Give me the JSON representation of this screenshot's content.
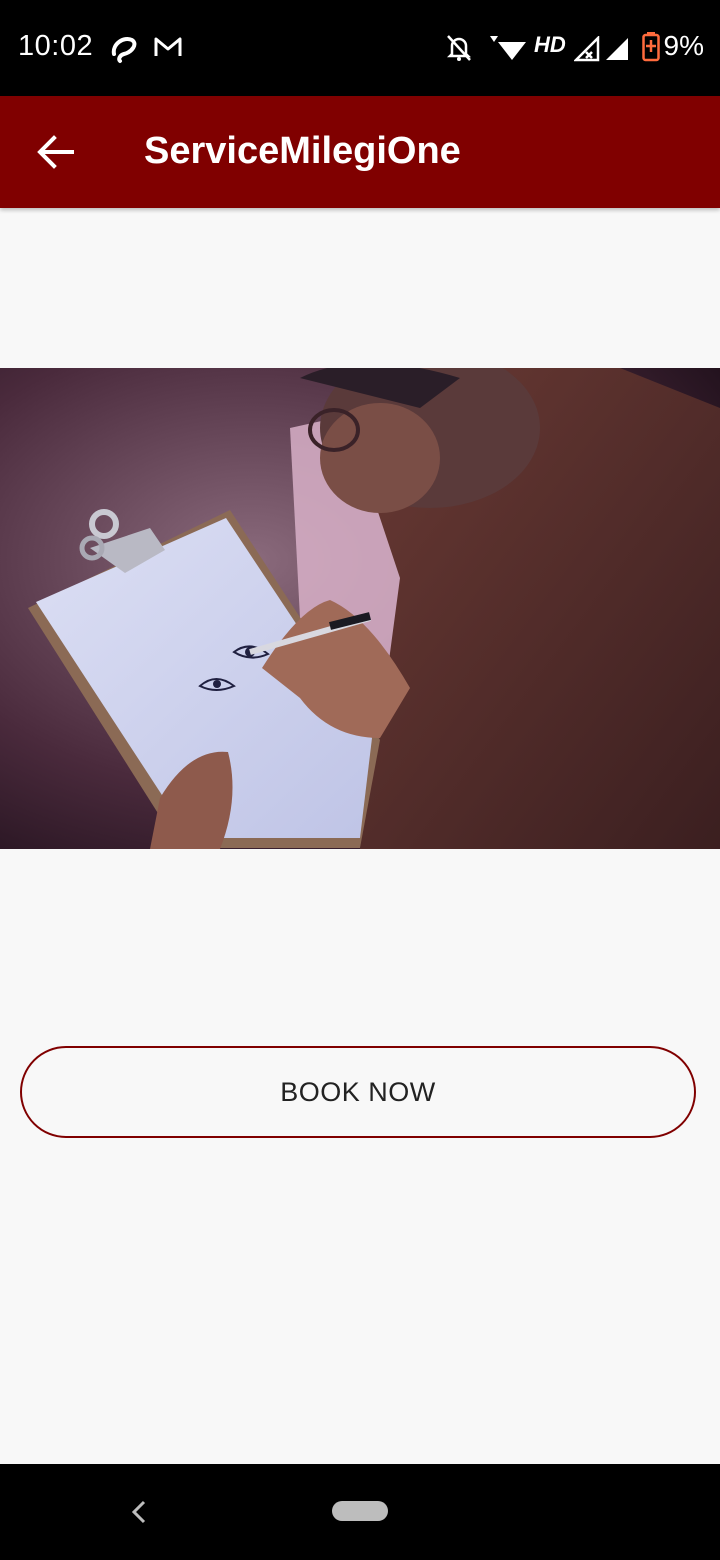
{
  "status_bar": {
    "time": "10:02",
    "network_label": "HD",
    "battery_percent": "9%",
    "icons": [
      "airtel-icon",
      "gmail-icon",
      "mute-icon",
      "wifi-icon",
      "signal-x-icon",
      "signal-icon",
      "battery-icon"
    ]
  },
  "app_bar": {
    "title": "ServiceMilegiOne",
    "back_icon": "arrow-left-icon",
    "background": "#800000"
  },
  "hero": {
    "description_icon": "artist-sketching-image"
  },
  "book_button": {
    "label": "BOOK NOW",
    "border_color": "#800000"
  },
  "nav_bar": {
    "back_icon": "chevron-left-icon",
    "home_icon": "home-pill-icon"
  }
}
